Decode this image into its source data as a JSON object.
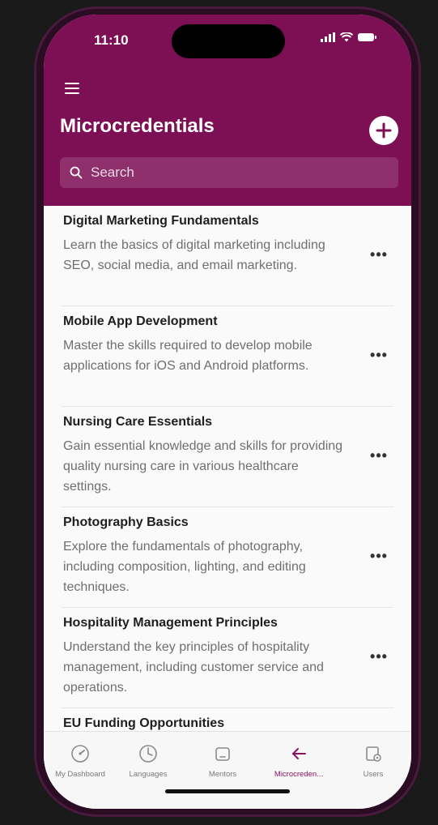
{
  "status": {
    "time": "11:10"
  },
  "header": {
    "title": "Microcredentials",
    "search_placeholder": "Search"
  },
  "items": [
    {
      "title": "Digital Marketing Fundamentals",
      "description": "Learn the basics of digital marketing including SEO, social media, and email marketing."
    },
    {
      "title": "Mobile App Development",
      "description": "Master the skills required to develop mobile applications for iOS and Android platforms."
    },
    {
      "title": "Nursing Care Essentials",
      "description": "Gain essential knowledge and skills for providing quality nursing care in various healthcare settings."
    },
    {
      "title": "Photography Basics",
      "description": "Explore the fundamentals of photography, including composition, lighting, and editing techniques."
    },
    {
      "title": "Hospitality Management Principles",
      "description": "Understand the key principles of hospitality management, including customer service and operations."
    },
    {
      "title": "EU Funding Opportunities",
      "description": ""
    }
  ],
  "more_label": "•••",
  "tabs": [
    {
      "label": "My Dashboard",
      "icon": "dashboard-gauge-icon",
      "active": false
    },
    {
      "label": "Languages",
      "icon": "clock-chart-icon",
      "active": false
    },
    {
      "label": "Mentors",
      "icon": "tablet-icon",
      "active": false
    },
    {
      "label": "Microcreden...",
      "icon": "arrow-left-icon",
      "active": true
    },
    {
      "label": "Users",
      "icon": "users-settings-icon",
      "active": false
    }
  ],
  "colors": {
    "brand": "#7d0f55",
    "active_tab": "#8b1360"
  }
}
